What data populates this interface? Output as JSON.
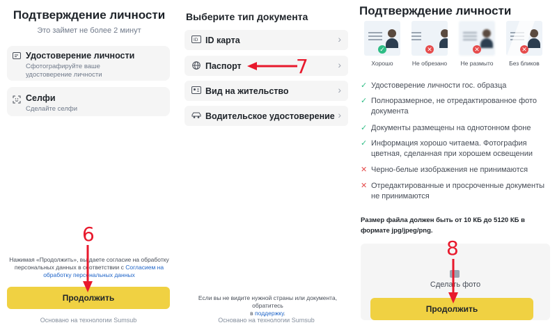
{
  "colors": {
    "accent": "#f0d142",
    "link": "#1e64c8",
    "ok": "#2ebd85",
    "error": "#e64b4b",
    "annotation": "#e8192c"
  },
  "screen1": {
    "title": "Подтверждение личности",
    "subtitle": "Это займет не более 2 минут",
    "cards": [
      {
        "icon": "id-card-icon",
        "title": "Удостоверение личности",
        "desc1": "Сфотографируйте ваше",
        "desc2": "удостоверение личности"
      },
      {
        "icon": "face-scan-icon",
        "title": "Селфи",
        "desc1": "Сделайте селфи"
      }
    ],
    "consent_line1": "Нажимая «Продолжить», вы даете согласие на обработку",
    "consent_line2_plain": "персональных данных в соответствии с ",
    "consent_line2_link": "Согласием на",
    "consent_line3_link": "обработку персональных данных",
    "button": "Продолжить",
    "footer": "Основано на технологии Sumsub"
  },
  "screen2": {
    "title": "Выберите тип документа",
    "documents": [
      {
        "icon": "id-card-icon",
        "label": "ID карта"
      },
      {
        "icon": "globe-icon",
        "label": "Паспорт"
      },
      {
        "icon": "residence-card-icon",
        "label": "Вид на жительство"
      },
      {
        "icon": "car-icon",
        "label": "Водительское удостоверение"
      }
    ],
    "note_line1": "Если вы не видите нужной страны или документа, обратитесь",
    "note_line2_plain": "в ",
    "note_line2_link": "поддержку",
    "note_line2_end": ".",
    "footer": "Основано на технологии Sumsub"
  },
  "screen3": {
    "title": "Подтверждение личности",
    "samples": [
      {
        "caption": "Хорошо",
        "status": "ok"
      },
      {
        "caption": "Не обрезано",
        "status": "bad"
      },
      {
        "caption": "Не размыто",
        "status": "bad"
      },
      {
        "caption": "Без бликов",
        "status": "bad"
      }
    ],
    "requirements": [
      {
        "ok": true,
        "text": "Удостоверение личности гос. образца"
      },
      {
        "ok": true,
        "text": "Полноразмерное, не отредактированное фото документа"
      },
      {
        "ok": true,
        "text": "Документы размещены на однотонном фоне"
      },
      {
        "ok": true,
        "text": "Информация хорошо читаема. Фотография цветная, сделанная при хорошем освещении"
      },
      {
        "ok": false,
        "text": "Черно-белые изображения не принимаются"
      },
      {
        "ok": false,
        "text": "Отредактированные и просроченные документы не принимаются"
      }
    ],
    "file_size_note": "Размер файла должен быть от 10 КБ до 5120 КБ в формате jpg/jpeg/png.",
    "upload_label": "Сделать фото",
    "button": "Продолжить"
  },
  "annotations": {
    "step6": "6",
    "step7": "7",
    "step8": "8"
  }
}
